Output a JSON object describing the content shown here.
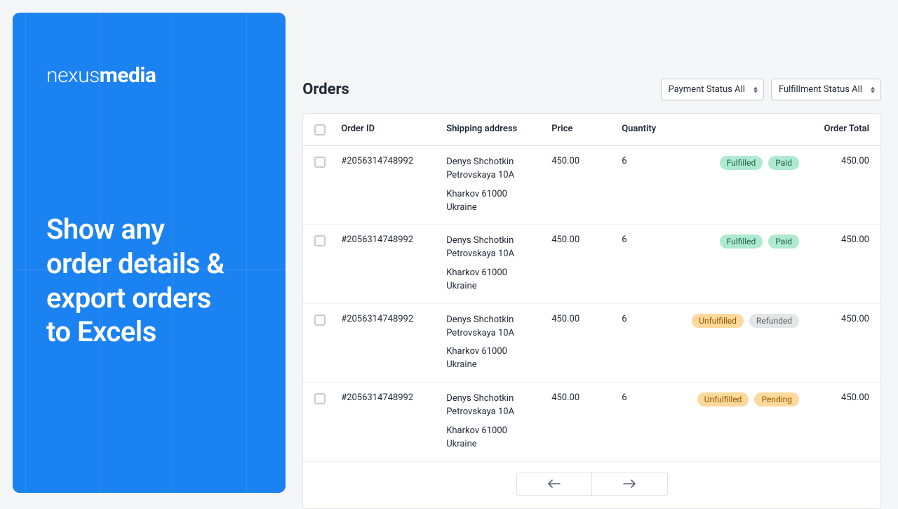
{
  "brand": {
    "light": "nexus",
    "bold": "media"
  },
  "headline": "Show any\norder details &\nexport orders\nto Excels",
  "page_title": "Orders",
  "filters": {
    "payment": "Payment Status All",
    "fulfillment": "Fulfillment Status All"
  },
  "columns": {
    "order_id": "Order ID",
    "shipping": "Shipping address",
    "price": "Price",
    "quantity": "Quantity",
    "total": "Order Total"
  },
  "rows": [
    {
      "id": "#2056314748992",
      "name": "Denys Shchotkin",
      "street": "Petrovskaya 10A",
      "city": "Kharkov 61000",
      "country": "Ukraine",
      "price": "450.00",
      "qty": "6",
      "fulfillment": {
        "label": "Fulfilled",
        "class": "badge-green"
      },
      "payment": {
        "label": "Paid",
        "class": "badge-green"
      },
      "total": "450.00"
    },
    {
      "id": "#2056314748992",
      "name": "Denys Shchotkin",
      "street": "Petrovskaya 10A",
      "city": "Kharkov 61000",
      "country": "Ukraine",
      "price": "450.00",
      "qty": "6",
      "fulfillment": {
        "label": "Fulfilled",
        "class": "badge-green"
      },
      "payment": {
        "label": "Paid",
        "class": "badge-green"
      },
      "total": "450.00"
    },
    {
      "id": "#2056314748992",
      "name": "Denys Shchotkin",
      "street": "Petrovskaya 10A",
      "city": "Kharkov 61000",
      "country": "Ukraine",
      "price": "450.00",
      "qty": "6",
      "fulfillment": {
        "label": "Unfulfilled",
        "class": "badge-yellow"
      },
      "payment": {
        "label": "Refunded",
        "class": "badge-gray"
      },
      "total": "450.00"
    },
    {
      "id": "#2056314748992",
      "name": "Denys Shchotkin",
      "street": "Petrovskaya 10A",
      "city": "Kharkov 61000",
      "country": "Ukraine",
      "price": "450.00",
      "qty": "6",
      "fulfillment": {
        "label": "Unfulfilled",
        "class": "badge-yellow"
      },
      "payment": {
        "label": "Pending",
        "class": "badge-yellow"
      },
      "total": "450.00"
    }
  ]
}
